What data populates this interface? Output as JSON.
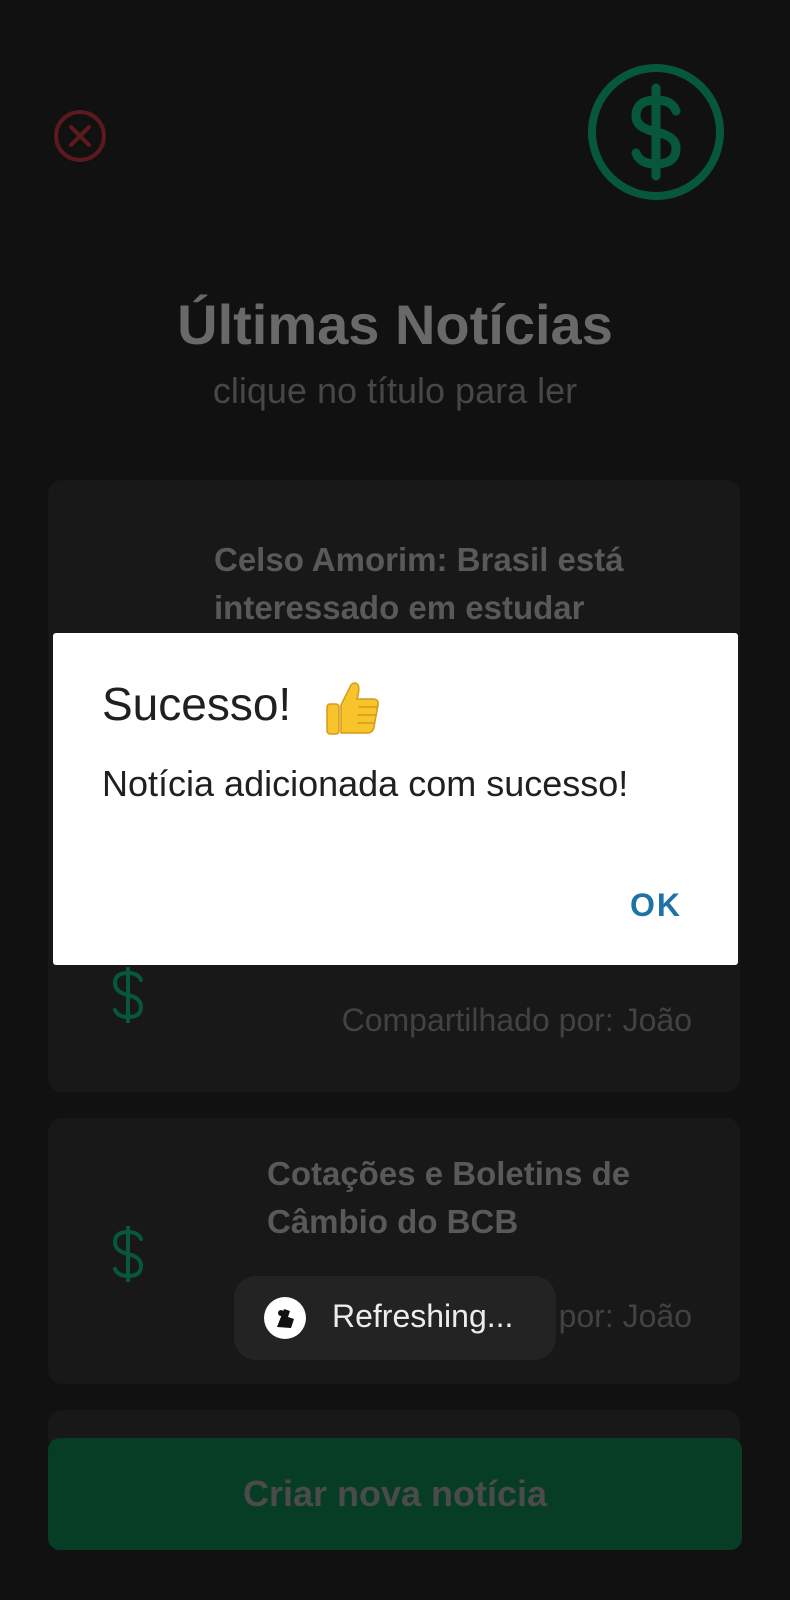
{
  "header": {
    "close_icon": "close-circle-icon",
    "logo_icon": "dollar-circle-icon",
    "title": "Últimas Notícias",
    "subtitle": "clique no título para ler"
  },
  "news": [
    {
      "title_line1": "Celso Amorim: Brasil está",
      "title_line2": "interessado em estudar",
      "author": "Compartilhado por: João",
      "icon": "dollar-icon"
    },
    {
      "title_line1": "Cotações e Boletins de",
      "title_line2": "Câmbio do BCB",
      "author": "Compartilhado por: João",
      "icon": "dollar-icon"
    }
  ],
  "create_button": "Criar nova notícia",
  "dialog": {
    "title": "Sucesso!",
    "title_icon": "thumbs-up-icon",
    "message": "Notícia adicionada com sucesso!",
    "ok": "OK"
  },
  "toast": {
    "text": "Refreshing...",
    "icon": "app-icon"
  },
  "colors": {
    "background": "#111111",
    "accent_green": "#07583a",
    "button_green": "#073d25",
    "close_red": "#5c1a1c",
    "ok_blue": "#1e72a8"
  }
}
